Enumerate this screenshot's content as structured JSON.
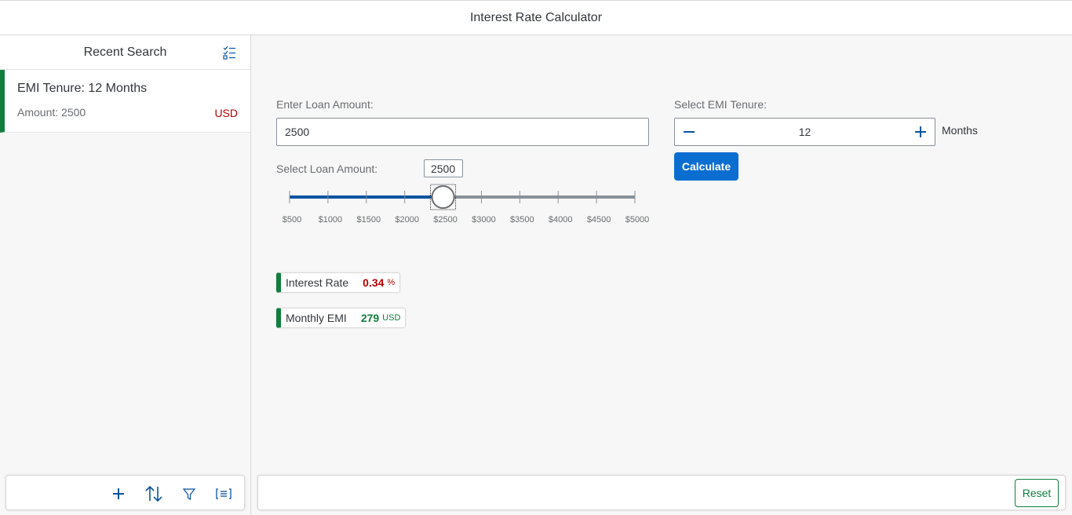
{
  "app": {
    "title": "Interest Rate Calculator"
  },
  "master": {
    "title": "Recent Search",
    "items": [
      {
        "title": "EMI Tenure: 12 Months",
        "amount": "Amount: 2500",
        "unit": "USD"
      }
    ],
    "footer_icons": [
      "add-icon",
      "sort-icon",
      "filter-icon",
      "group-icon"
    ]
  },
  "form": {
    "loan_label": "Enter Loan Amount:",
    "loan_value": "2500",
    "slider_label": "Select Loan Amount:",
    "slider_value": "2500",
    "slider": {
      "min": 500,
      "max": 5000,
      "step": 500,
      "value": 2500,
      "ticks": [
        "$500",
        "$1000",
        "$1500",
        "$2000",
        "$2500",
        "$3000",
        "$3500",
        "$4000",
        "$4500",
        "$5000"
      ]
    },
    "tenure_label": "Select EMI Tenure:",
    "tenure_value": "12",
    "tenure_unit": "Months",
    "calculate_label": "Calculate"
  },
  "results": {
    "interest": {
      "label": "Interest Rate",
      "value": "0.34",
      "unit": "%"
    },
    "emi": {
      "label": "Monthly EMI",
      "value": "279",
      "unit": "USD"
    }
  },
  "footer": {
    "reset_label": "Reset"
  },
  "colors": {
    "accent": "#0a6ed1",
    "positive": "#107e3e",
    "negative": "#bb0000",
    "slider": "#0854a0"
  }
}
